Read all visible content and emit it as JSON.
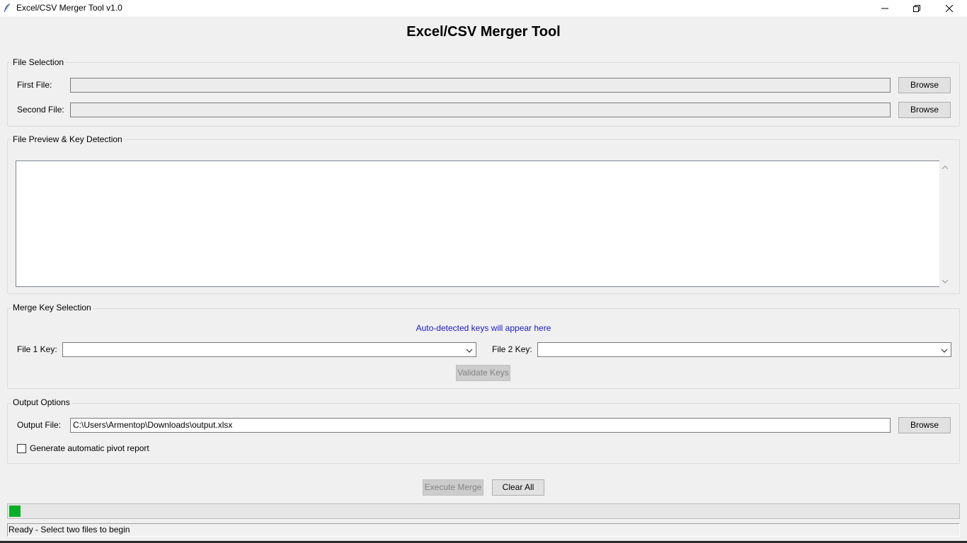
{
  "window": {
    "title": "Excel/CSV Merger Tool v1.0"
  },
  "heading": "Excel/CSV Merger Tool",
  "file_selection": {
    "group_label": "File Selection",
    "first_file_label": "First File:",
    "first_file_value": "",
    "second_file_label": "Second File:",
    "second_file_value": "",
    "browse_label": "Browse"
  },
  "preview": {
    "group_label": "File Preview & Key Detection",
    "content": ""
  },
  "merge_keys": {
    "group_label": "Merge Key Selection",
    "info_text": "Auto-detected keys will appear here",
    "file1_label": "File 1 Key:",
    "file1_value": "",
    "file2_label": "File 2 Key:",
    "file2_value": "",
    "validate_label": "Validate Keys"
  },
  "output": {
    "group_label": "Output Options",
    "output_file_label": "Output File:",
    "output_file_value": "C:\\Users\\Armentop\\Downloads\\output.xlsx",
    "browse_label": "Browse",
    "pivot_label": "Generate automatic pivot report",
    "pivot_checked": false
  },
  "actions": {
    "execute_label": "Execute Merge",
    "clear_label": "Clear All"
  },
  "progress": {
    "value_fraction": 0.012,
    "color": "#06b025"
  },
  "status": {
    "text": "Ready - Select two files to begin"
  },
  "icons": {
    "app": "feather-icon",
    "minimize": "minimize-icon",
    "maximize": "restore-icon",
    "close": "close-icon",
    "scroll_up": "chevron-up-icon",
    "scroll_down": "chevron-down-icon",
    "combo": "chevron-down-icon"
  },
  "colors": {
    "info_text": "#1a1acc",
    "window_bg": "#f0f0f0"
  }
}
